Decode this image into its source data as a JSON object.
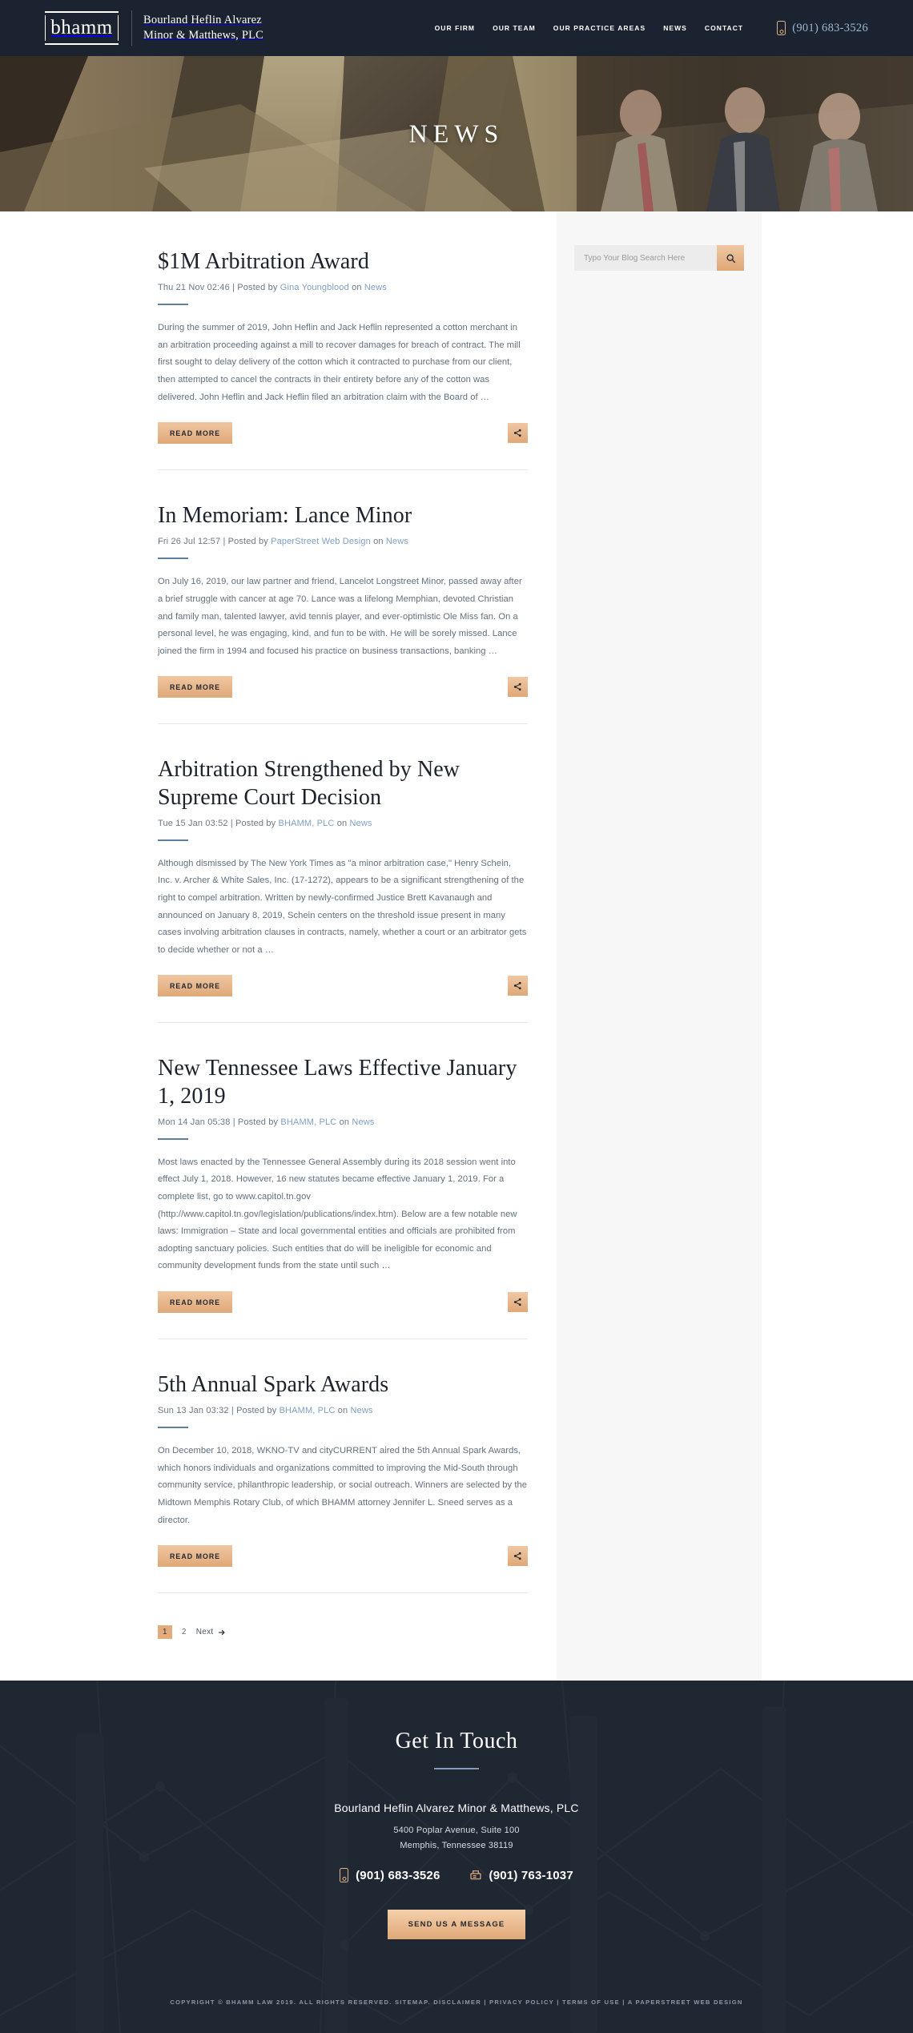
{
  "header": {
    "logo_word": "bhamm",
    "brand_line1": "Bourland Heflin Alvarez",
    "brand_line2": "Minor & Matthews, PLC",
    "nav": [
      {
        "label": "OUR FIRM"
      },
      {
        "label": "OUR TEAM"
      },
      {
        "label": "OUR PRACTICE AREAS"
      },
      {
        "label": "NEWS"
      },
      {
        "label": "CONTACT"
      }
    ],
    "phone": "(901) 683-3526",
    "phone_icon": "mobile-phone-icon"
  },
  "hero": {
    "title": "NEWS"
  },
  "sidebar": {
    "search": {
      "placeholder": "Typo Your Blog Search Here",
      "value": "",
      "submit_icon": "search-icon"
    }
  },
  "posts": [
    {
      "title": "$1M Arbitration Award",
      "date": "Thu 21 Nov 02:46",
      "posted_by_label": "| Posted by",
      "author": "Gina Youngblood",
      "on_label": "on",
      "category": "News",
      "excerpt": "During the summer of 2019, John Heflin and Jack Heflin represented a cotton merchant in an arbitration proceeding against a mill to recover damages for breach of contract. The mill first sought to delay delivery of the cotton which it contracted to purchase from our client, then attempted to cancel the contracts in their entirety before any of the cotton was delivered. John Heflin and Jack Heflin filed an arbitration claim with the Board of …",
      "read_more": "READ MORE",
      "share_icon": "share-icon"
    },
    {
      "title": "In Memoriam: Lance Minor",
      "date": "Fri 26 Jul 12:57",
      "posted_by_label": "| Posted by",
      "author": "PaperStreet Web Design",
      "on_label": "on",
      "category": "News",
      "excerpt": "On July 16, 2019, our law partner and friend, Lancelot Longstreet Minor, passed away after a brief struggle with cancer at age 70. Lance was a lifelong Memphian, devoted Christian and family man, talented lawyer, avid tennis player, and ever-optimistic Ole Miss fan.  On a personal level, he was engaging, kind, and fun to be with.  He will be sorely missed. Lance joined the firm in 1994 and focused his practice on business transactions, banking …",
      "read_more": "READ MORE",
      "share_icon": "share-icon"
    },
    {
      "title": "Arbitration Strengthened by New Supreme Court Decision",
      "date": "Tue 15 Jan 03:52",
      "posted_by_label": "| Posted by",
      "author": "BHAMM, PLC",
      "on_label": "on",
      "category": "News",
      "excerpt": "Although dismissed by The New York Times as \"a minor arbitration case,\" Henry Schein, Inc. v. Archer & White Sales, Inc. (17-1272), appears to be a significant strengthening of the right to compel arbitration. Written by newly-confirmed Justice Brett Kavanaugh and announced on January 8, 2019, Schein centers on the threshold issue present in many cases involving arbitration clauses in contracts, namely, whether a court or an arbitrator gets to decide whether or not a …",
      "read_more": "READ MORE",
      "share_icon": "share-icon"
    },
    {
      "title": "New Tennessee Laws Effective January 1, 2019",
      "date": "Mon 14 Jan 05:38",
      "posted_by_label": "| Posted by",
      "author": "BHAMM, PLC",
      "on_label": "on",
      "category": "News",
      "excerpt": "Most laws enacted by the Tennessee General Assembly during its 2018 session went into effect July 1, 2018. However, 16 new statutes became effective January 1, 2019. For a complete list, go to www.capitol.tn.gov (http://www.capitol.tn.gov/legislation/publications/index.htm).  Below are a few notable new laws: Immigration – State and local governmental entities and officials are prohibited from adopting sanctuary policies. Such entities that do will be ineligible for economic and community development funds from the state until such …",
      "read_more": "READ MORE",
      "share_icon": "share-icon"
    },
    {
      "title": "5th Annual Spark Awards",
      "date": "Sun 13 Jan 03:32",
      "posted_by_label": "| Posted by",
      "author": "BHAMM, PLC",
      "on_label": "on",
      "category": "News",
      "excerpt": "On December 10, 2018, WKNO-TV and cityCURRENT aired the 5th Annual Spark Awards, which honors individuals and organizations committed to improving the Mid-South through community service, philanthropic leadership, or social outreach. Winners are selected by the Midtown Memphis Rotary Club, of which BHAMM attorney Jennifer L. Sneed serves as a director.",
      "read_more": "READ MORE",
      "share_icon": "share-icon"
    }
  ],
  "pagination": {
    "pages": [
      "1",
      "2"
    ],
    "current": "1",
    "next_label": "Next",
    "next_icon": "arrow-right-icon"
  },
  "footer": {
    "title": "Get In Touch",
    "firm": "Bourland Heflin Alvarez Minor & Matthews, PLC",
    "address_line1": "5400 Poplar Avenue, Suite 100",
    "address_line2": "Memphis, Tennessee 38119",
    "phone": "(901) 683-3526",
    "phone_icon": "mobile-phone-icon",
    "fax": "(901) 763-1037",
    "fax_icon": "fax-machine-icon",
    "cta_label": "SEND US A MESSAGE",
    "copyright": "COPYRIGHT © BHAMM LAW 2019. ALL RIGHTS RESERVED. SITEMAP. DISCLAIMER | PRIVACY POLICY | TERMS OF USE | A PAPERSTREET WEB DESIGN"
  },
  "colors": {
    "header_bg": "#1b2330",
    "accent_peach": "#dfa877",
    "link_blue": "#7fa0c4",
    "footer_bg": "#212934",
    "body_text": "#61707f"
  }
}
